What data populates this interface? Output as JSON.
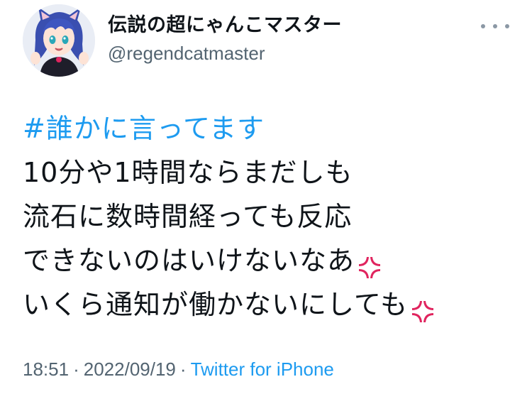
{
  "user": {
    "display_name": "伝説の超にゃんこマスター",
    "handle": "@regendcatmaster",
    "avatar_icon": "anime-catgirl-avatar"
  },
  "menu": {
    "icon": "more-options-icon"
  },
  "tweet": {
    "hashtag": "#誰かに言ってます",
    "lines": [
      "10分や1時間ならまだしも",
      "流石に数時間経っても反応",
      "できないのはいけないなあ",
      "いくら通知が働かないにしても"
    ],
    "emoji": "anger-symbol-icon"
  },
  "meta": {
    "time": "18:51",
    "separator": "·",
    "date": "2022/09/19",
    "source": "Twitter for iPhone"
  },
  "colors": {
    "link": "#1d9bf0",
    "secondary_text": "#536471",
    "primary_text": "#0f1419",
    "anger": "#e0245e"
  }
}
